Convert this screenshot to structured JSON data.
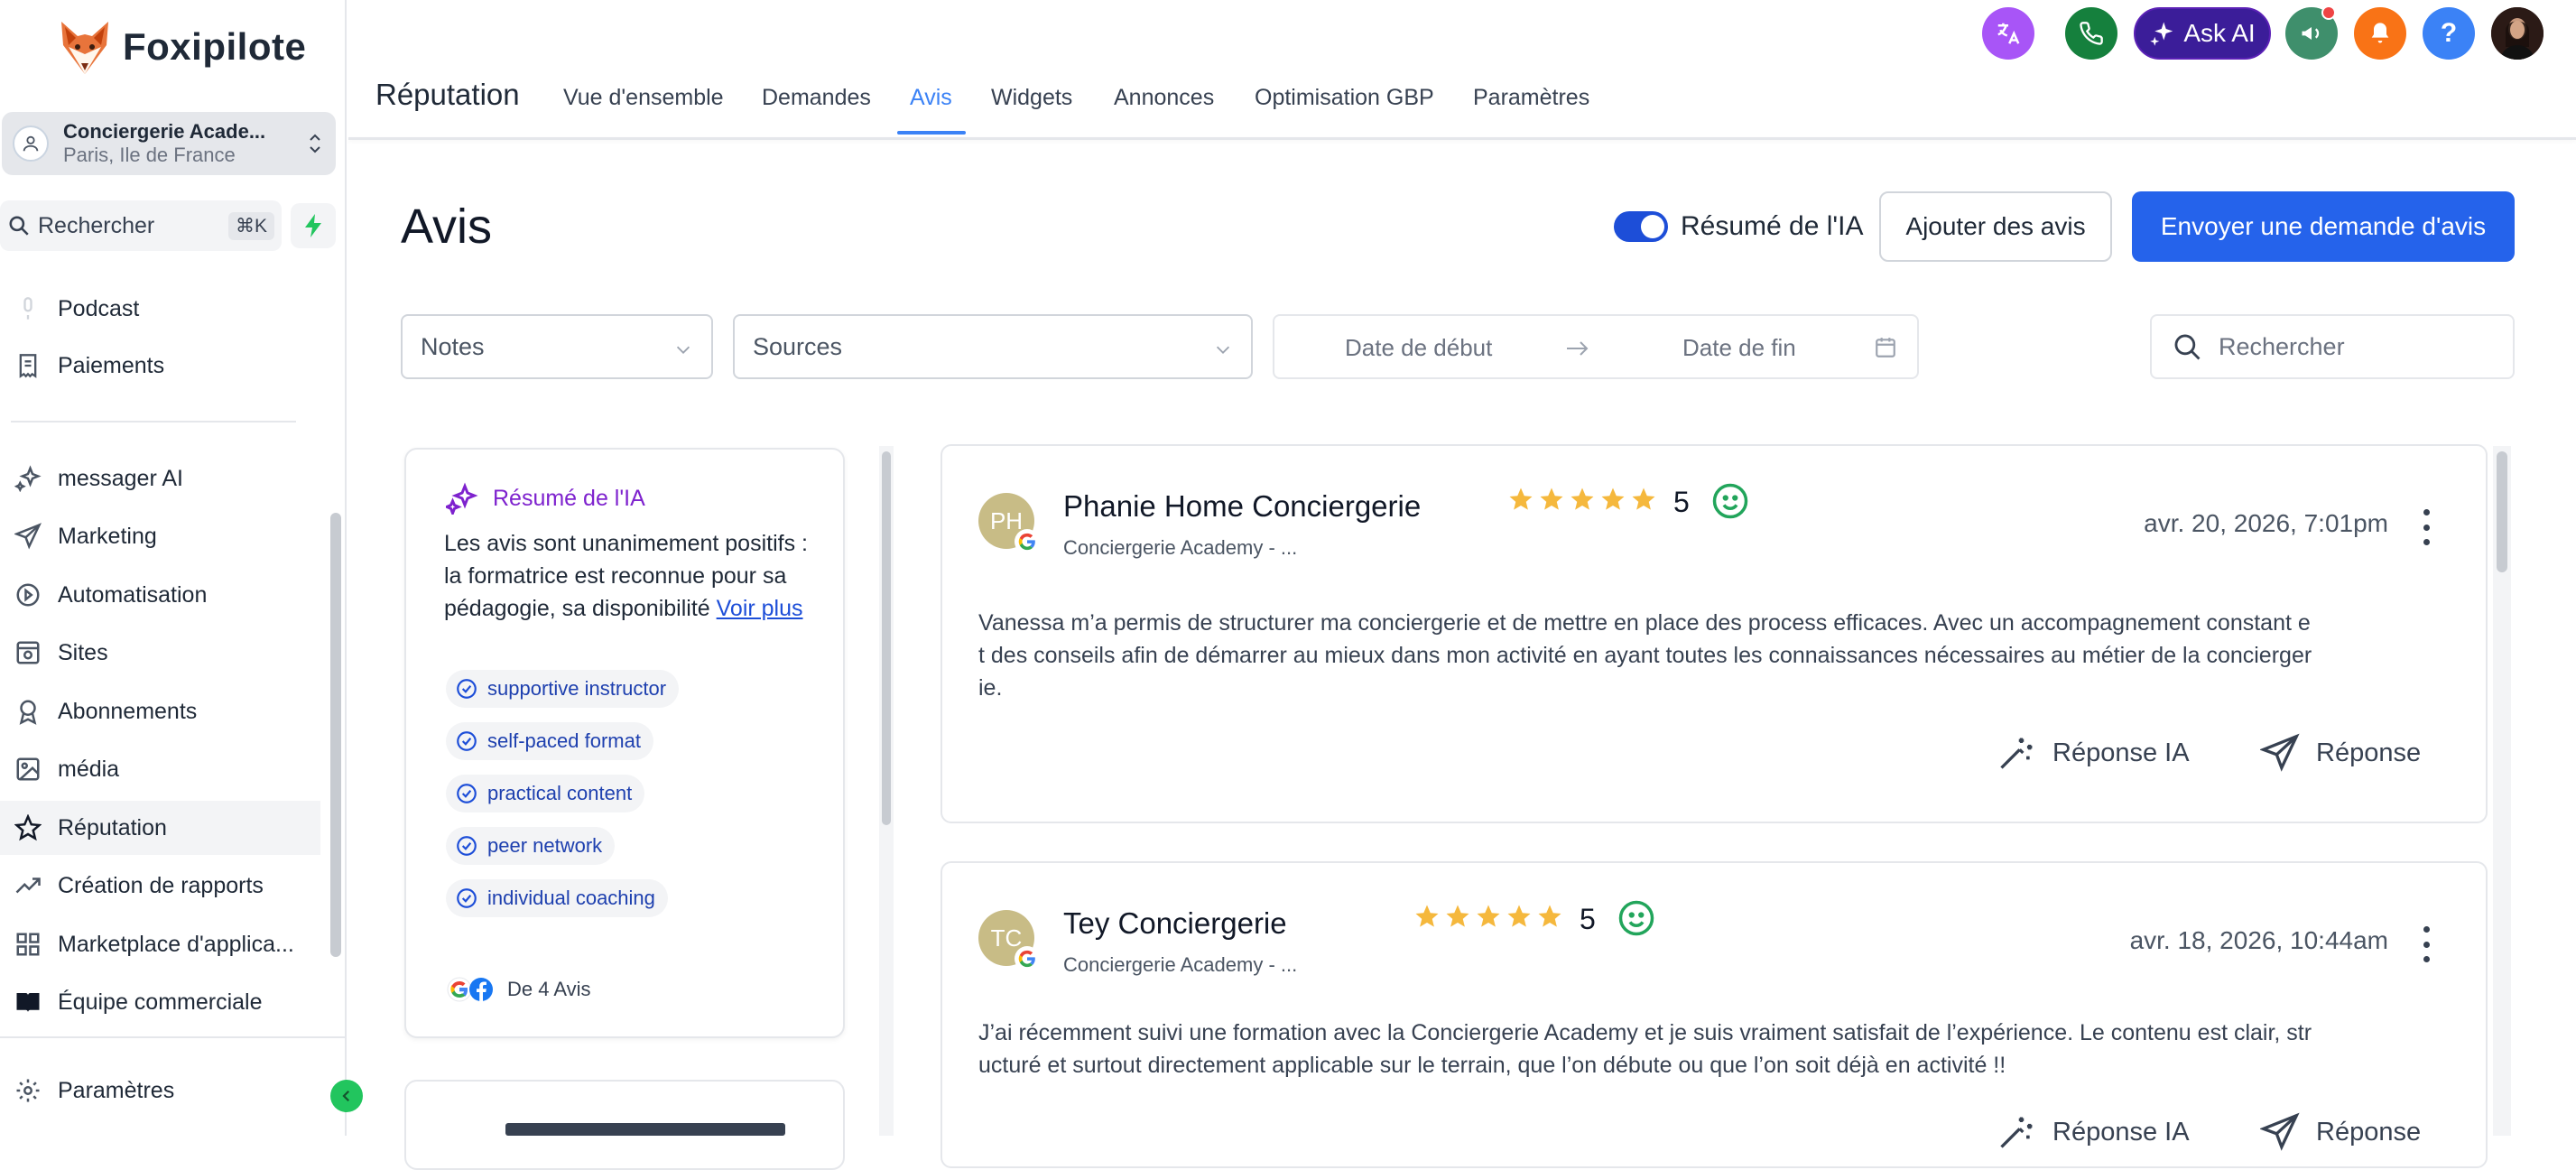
{
  "app": {
    "name": "Foxipilote"
  },
  "location": {
    "name": "Conciergerie Acade...",
    "city": "Paris, Ile de France"
  },
  "sidebar": {
    "search_label": "Rechercher",
    "search_shortcut": "⌘K",
    "items": [
      {
        "label": "Podcast",
        "icon": "podcast-icon"
      },
      {
        "label": "Paiements",
        "icon": "receipt-icon"
      },
      {
        "label": "messager AI",
        "icon": "sparkles-icon"
      },
      {
        "label": "Marketing",
        "icon": "send-icon"
      },
      {
        "label": "Automatisation",
        "icon": "automation-icon"
      },
      {
        "label": "Sites",
        "icon": "sites-icon"
      },
      {
        "label": "Abonnements",
        "icon": "badge-icon"
      },
      {
        "label": "média",
        "icon": "image-icon"
      },
      {
        "label": "Réputation",
        "icon": "star-icon",
        "active": true
      },
      {
        "label": "Création de rapports",
        "icon": "trend-icon"
      },
      {
        "label": "Marketplace d'applica...",
        "icon": "apps-icon"
      },
      {
        "label": "Équipe commerciale",
        "icon": "book-icon"
      }
    ],
    "settings_label": "Paramètres"
  },
  "topbar": {
    "ask_ai_label": "Ask AI"
  },
  "header": {
    "title": "Réputation",
    "tabs": [
      {
        "label": "Vue d'ensemble"
      },
      {
        "label": "Demandes"
      },
      {
        "label": "Avis",
        "active": true
      },
      {
        "label": "Widgets"
      },
      {
        "label": "Annonces"
      },
      {
        "label": "Optimisation GBP"
      },
      {
        "label": "Paramètres"
      }
    ]
  },
  "main": {
    "title": "Avis",
    "ai_toggle_label": "Résumé de l'IA",
    "ai_toggle_on": true,
    "add_reviews_label": "Ajouter des avis",
    "send_request_label": "Envoyer une demande d'avis",
    "filters": {
      "ratings_placeholder": "Notes",
      "sources_placeholder": "Sources",
      "start_date_placeholder": "Date de début",
      "end_date_placeholder": "Date de fin",
      "search_placeholder": "Rechercher"
    }
  },
  "ai_summary": {
    "title": "Résumé de l'IA",
    "text": "Les avis sont unanimement positifs : la formatrice est reconnue pour sa pédagogie, sa disponibilité",
    "more_link": "Voir plus",
    "tags": [
      "supportive instructor",
      "self-paced format",
      "practical content",
      "peer network",
      "individual coaching"
    ],
    "source_label": "De 4 Avis"
  },
  "reviews": [
    {
      "initials": "PH",
      "name": "Phanie Home Conciergerie",
      "business": "Conciergerie Academy - ...",
      "rating": 5,
      "rating_label": "5",
      "date": "avr. 20, 2026, 7:01pm",
      "text": "Vanessa m’a permis de structurer ma conciergerie et de mettre en place des process efficaces. Avec un accompagnement constant et des conseils afin de démarrer au mieux dans mon activité en ayant toutes les connaissances nécessaires au métier de la conciergerie.",
      "ai_reply_label": "Réponse IA",
      "reply_label": "Réponse"
    },
    {
      "initials": "TC",
      "name": "Tey Conciergerie",
      "business": "Conciergerie Academy - ...",
      "rating": 5,
      "rating_label": "5",
      "date": "avr. 18, 2026, 10:44am",
      "text": "J’ai récemment suivi une formation avec la Conciergerie Academy et je suis vraiment satisfait de l’expérience. Le contenu est clair, structuré et surtout directement applicable sur le terrain, que l’on débute ou que l’on soit déjà en activité !!",
      "ai_reply_label": "Réponse IA",
      "reply_label": "Réponse"
    }
  ],
  "colors": {
    "accent": "#2563eb",
    "tab_active": "#3b82f6",
    "ai_purple": "#7e22ce",
    "star": "#f5b83d",
    "smiley": "#22a55b"
  }
}
